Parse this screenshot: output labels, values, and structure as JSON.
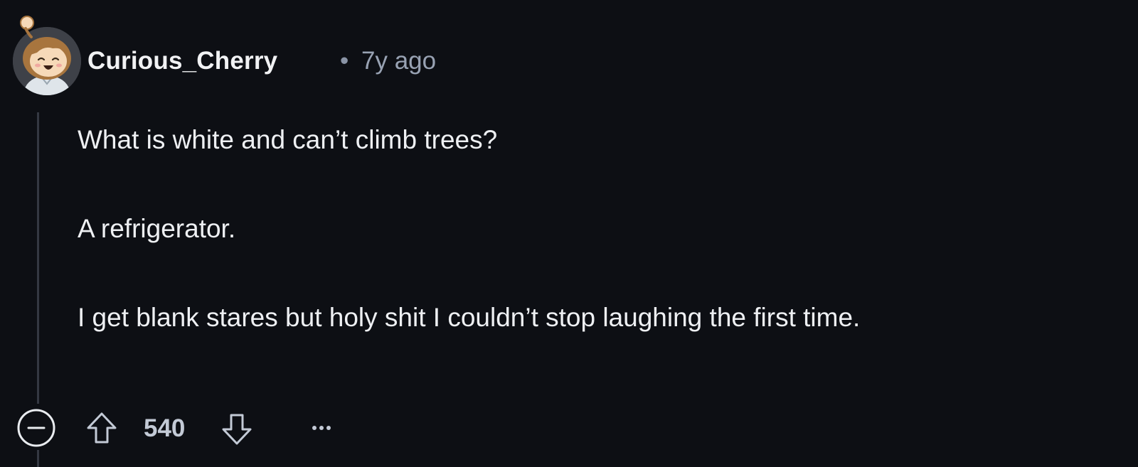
{
  "comment": {
    "author": "Curious_Cherry",
    "separator": "•",
    "time_ago": "7y ago",
    "body": [
      "What is white and can’t climb trees?",
      "A refrigerator.",
      "I get blank stares but holy shit I couldn’t stop laughing the first time."
    ],
    "score": "540"
  },
  "icons": {
    "collapse": "minus-circle-icon",
    "upvote": "arrow-up-icon",
    "downvote": "arrow-down-icon",
    "more": "more-horizontal-icon",
    "avatar": "avatar-icon"
  },
  "colors": {
    "background": "#0d0f14",
    "text": "#eef0f3",
    "meta": "#98a2b3",
    "thread_line": "#343842"
  }
}
